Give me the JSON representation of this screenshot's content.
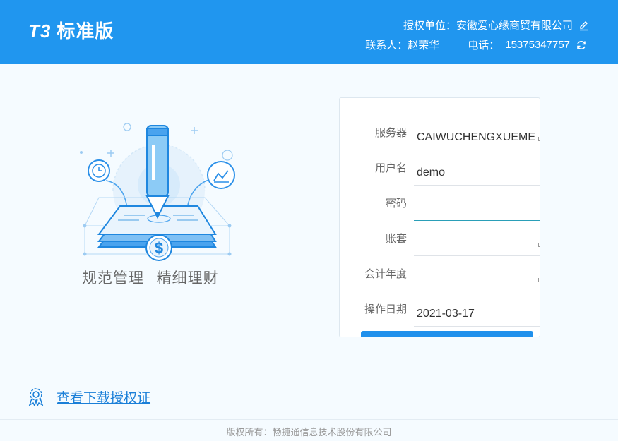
{
  "header": {
    "logo_prefix": "T3",
    "logo_text": "标准版",
    "license_unit": "授权单位：安徽爱心缘商贸有限公司",
    "contact": "联系人：赵荣华",
    "phone_label": "电话：",
    "phone": "15375347757"
  },
  "illustration": {
    "slogan": "规范管理 精细理财"
  },
  "login": {
    "server_label": "服务器",
    "server_value": "CAIWUCHENGXUEME",
    "user_label": "用户名",
    "user_value": "demo",
    "password_label": "密码",
    "password_value": "",
    "account_label": "账套",
    "account_value": "",
    "year_label": "会计年度",
    "year_value": "",
    "date_label": "操作日期",
    "date_value": "2021-03-17"
  },
  "license_link": "查看下载授权证",
  "footer": "版权所有：畅捷通信息技术股份有限公司",
  "colors": {
    "header_bg": "#2096ef",
    "accent": "#1f90ec",
    "page_bg": "#f5fbff"
  }
}
